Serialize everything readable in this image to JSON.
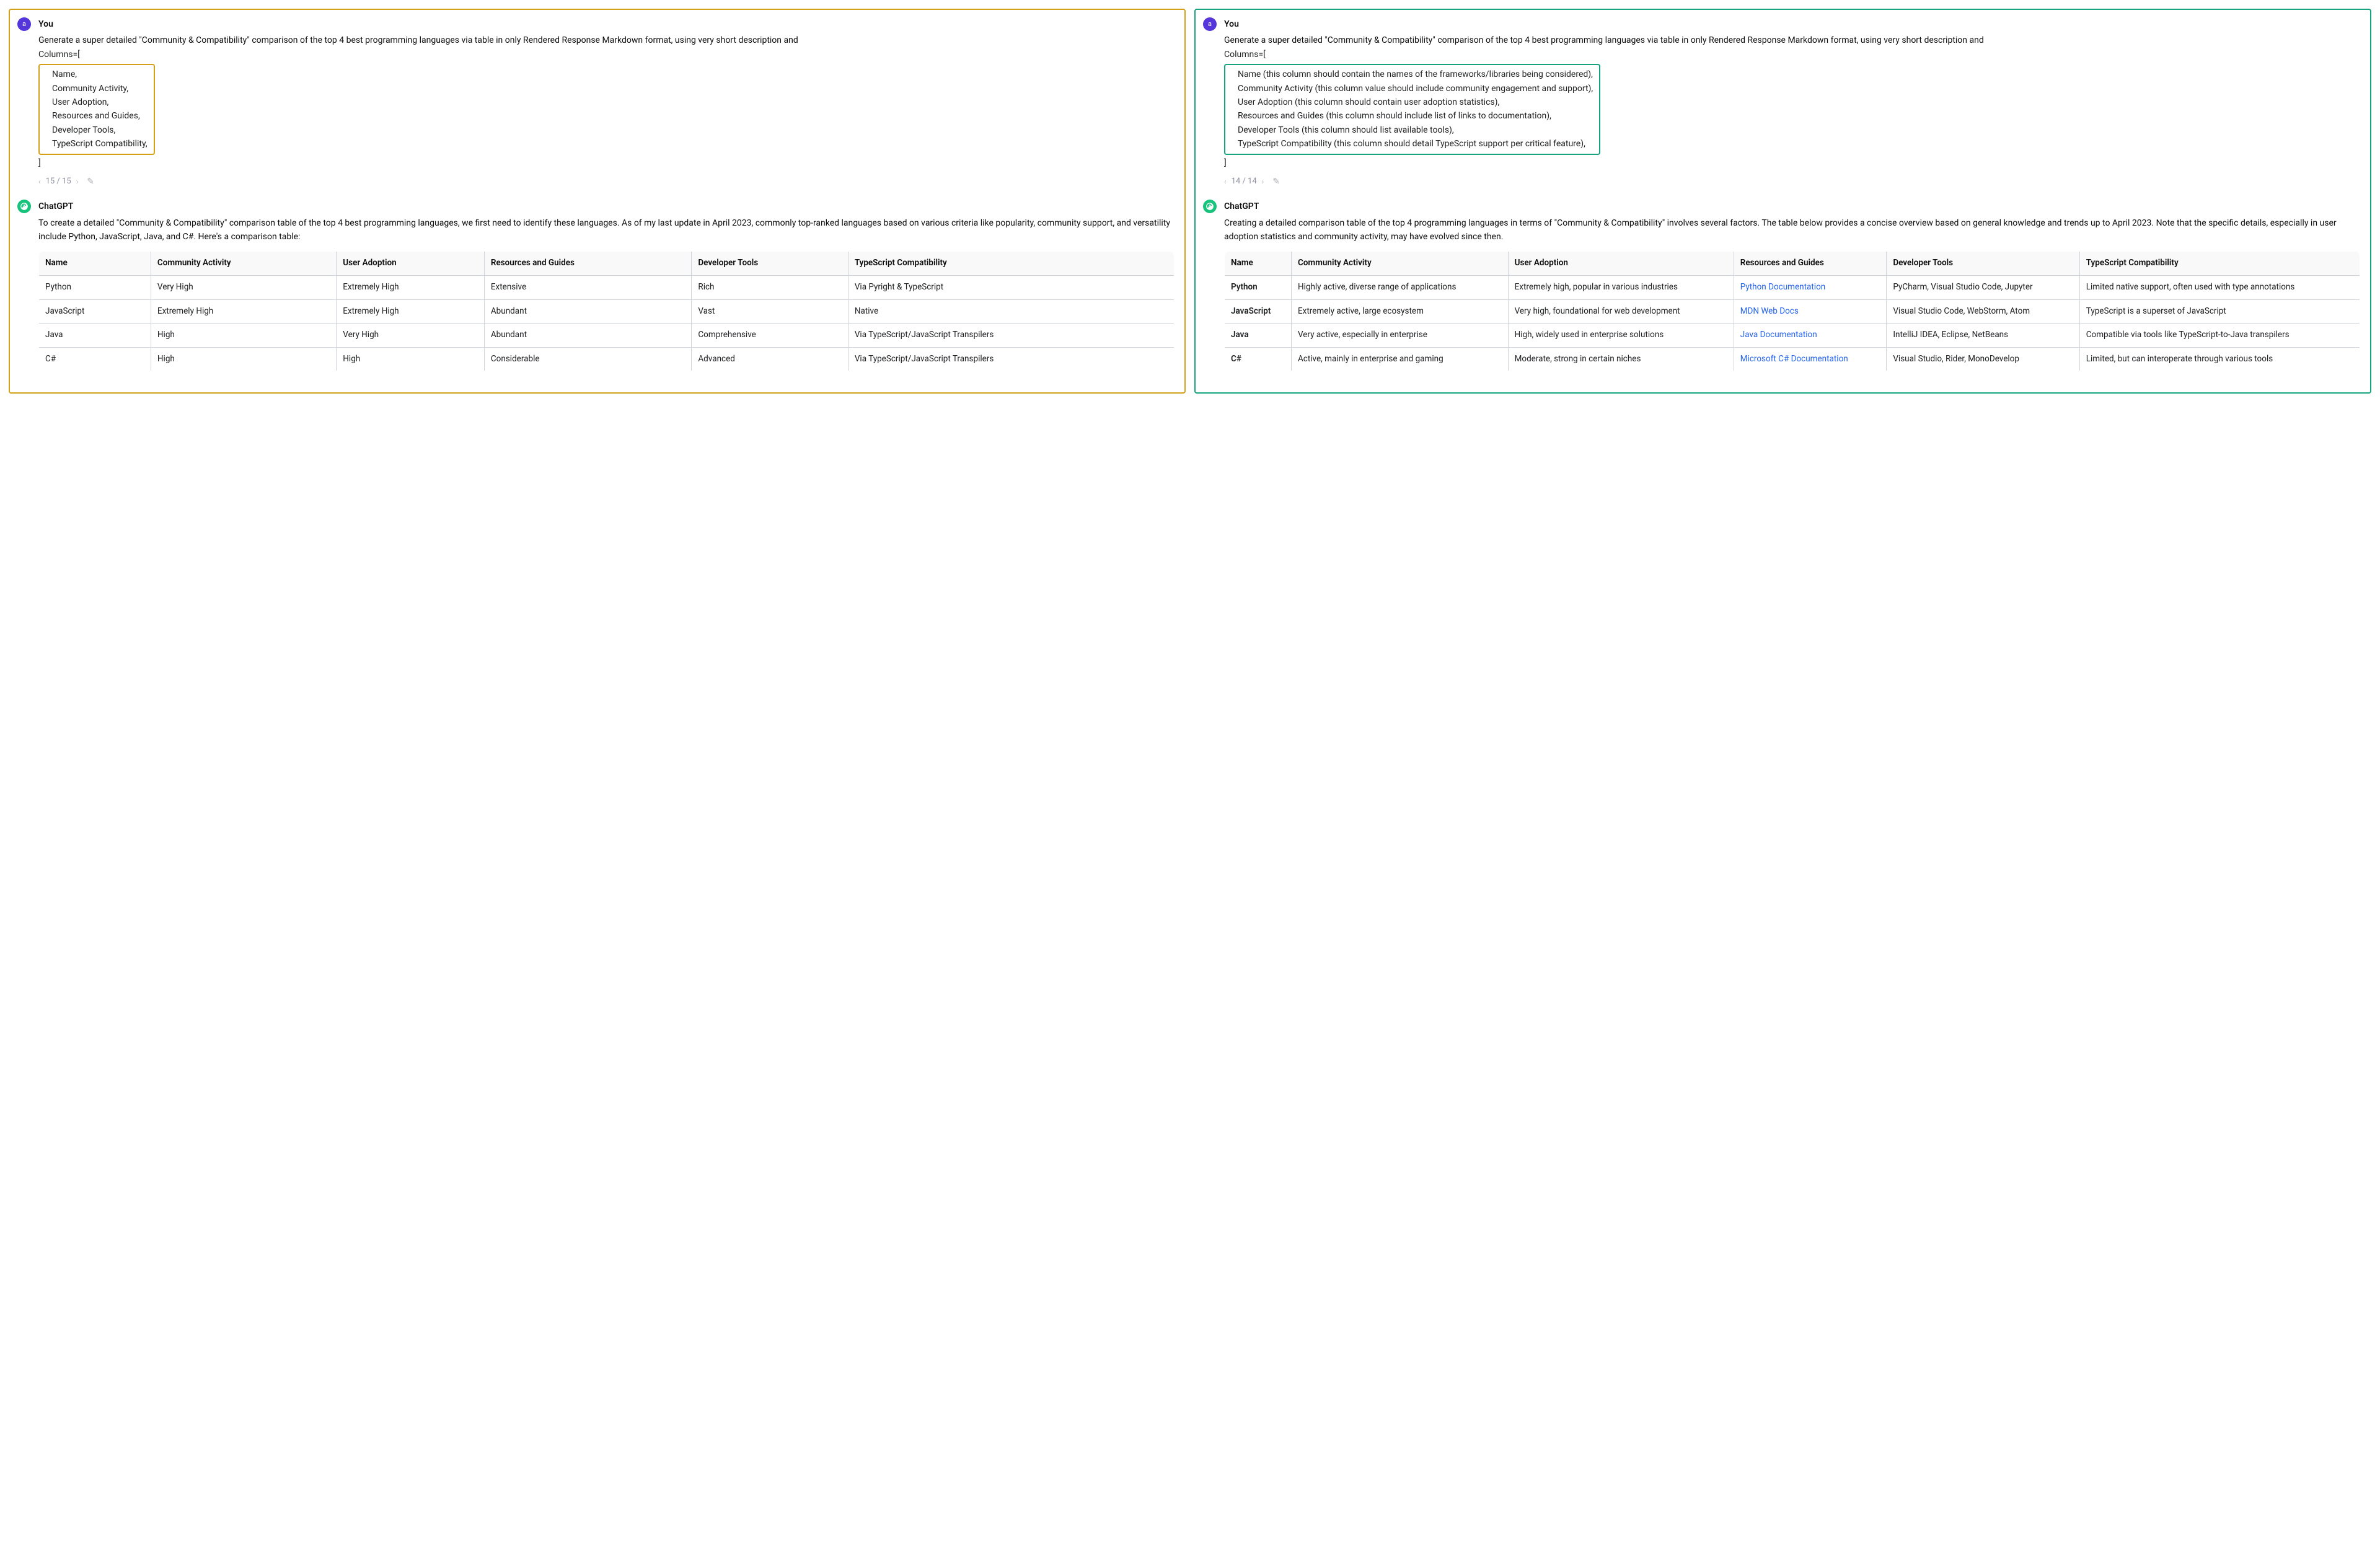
{
  "left": {
    "user_label": "You",
    "user_avatar": "a",
    "prompt_intro": "Generate a super detailed \"Community & Compatibility\" comparison of the top 4 best programming languages via table in only Rendered Response Markdown format, using very short description and",
    "cols_open": "Columns=[",
    "cols": [
      "Name,",
      "Community Activity,",
      "User Adoption,",
      "Resources and Guides,",
      "Developer Tools,",
      "TypeScript Compatibility,"
    ],
    "cols_close": "]",
    "pager": "15 / 15",
    "gpt_label": "ChatGPT",
    "response": "To create a detailed \"Community & Compatibility\" comparison table of the top 4 best programming languages, we first need to identify these languages. As of my last update in April 2023, commonly top-ranked languages based on various criteria like popularity, community support, and versatility include Python, JavaScript, Java, and C#. Here's a comparison table:",
    "table": {
      "headers": [
        "Name",
        "Community Activity",
        "User Adoption",
        "Resources and Guides",
        "Developer Tools",
        "TypeScript Compatibility"
      ],
      "rows": [
        [
          "Python",
          "Very High",
          "Extremely High",
          "Extensive",
          "Rich",
          "Via Pyright & TypeScript"
        ],
        [
          "JavaScript",
          "Extremely High",
          "Extremely High",
          "Abundant",
          "Vast",
          "Native"
        ],
        [
          "Java",
          "High",
          "Very High",
          "Abundant",
          "Comprehensive",
          "Via TypeScript/JavaScript Transpilers"
        ],
        [
          "C#",
          "High",
          "High",
          "Considerable",
          "Advanced",
          "Via TypeScript/JavaScript Transpilers"
        ]
      ]
    }
  },
  "right": {
    "user_label": "You",
    "user_avatar": "a",
    "prompt_intro": "Generate a super detailed \"Community & Compatibility\" comparison of the top 4 best programming languages via table in only Rendered Response Markdown format, using very short description and",
    "cols_open": "Columns=[",
    "cols": [
      "Name (this column should contain the names of the frameworks/libraries being considered),",
      "Community Activity (this column value should include community engagement and support),",
      "User Adoption (this column should contain user adoption statistics),",
      "Resources and Guides (this column should include list of links to documentation),",
      "Developer Tools (this column should list available tools),",
      "TypeScript Compatibility (this column should detail TypeScript support per critical feature),"
    ],
    "cols_close": "]",
    "pager": "14 / 14",
    "gpt_label": "ChatGPT",
    "response": "Creating a detailed comparison table of the top 4 programming languages in terms of \"Community & Compatibility\" involves several factors. The table below provides a concise overview based on general knowledge and trends up to April 2023. Note that the specific details, especially in user adoption statistics and community activity, may have evolved since then.",
    "table": {
      "headers": [
        "Name",
        "Community Activity",
        "User Adoption",
        "Resources and Guides",
        "Developer Tools",
        "TypeScript Compatibility"
      ],
      "rows": [
        {
          "name": "Python",
          "ca": "Highly active, diverse range of applications",
          "ua": "Extremely high, popular in various industries",
          "rg": "Python Documentation",
          "dt": "PyCharm, Visual Studio Code, Jupyter",
          "tc": "Limited native support, often used with type annotations"
        },
        {
          "name": "JavaScript",
          "ca": "Extremely active, large ecosystem",
          "ua": "Very high, foundational for web development",
          "rg": "MDN Web Docs",
          "dt": "Visual Studio Code, WebStorm, Atom",
          "tc": "TypeScript is a superset of JavaScript"
        },
        {
          "name": "Java",
          "ca": "Very active, especially in enterprise",
          "ua": "High, widely used in enterprise solutions",
          "rg": "Java Documentation",
          "dt": "IntelliJ IDEA, Eclipse, NetBeans",
          "tc": "Compatible via tools like TypeScript-to-Java transpilers"
        },
        {
          "name": "C#",
          "ca": "Active, mainly in enterprise and gaming",
          "ua": "Moderate, strong in certain niches",
          "rg": "Microsoft C# Documentation",
          "dt": "Visual Studio, Rider, MonoDevelop",
          "tc": "Limited, but can interoperate through various tools"
        }
      ]
    }
  }
}
